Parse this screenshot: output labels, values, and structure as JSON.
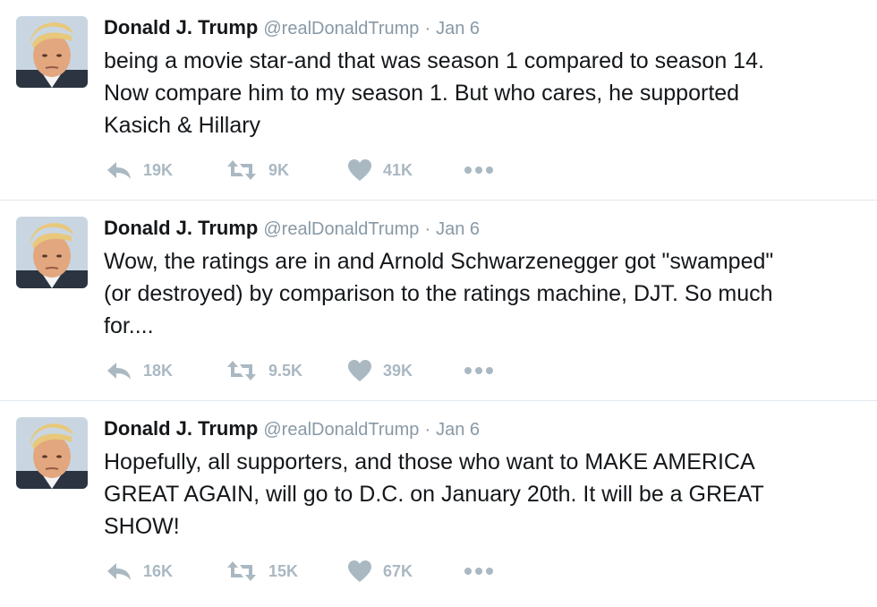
{
  "tweets": [
    {
      "author": "Donald J. Trump",
      "handle": "@realDonaldTrump",
      "separator": "·",
      "date": "Jan 6",
      "text": "being a movie star-and that was season 1 compared to season 14.\nNow compare him to my season 1. But who cares, he supported\nKasich & Hillary",
      "replies": "19K",
      "retweets": "9K",
      "likes": "41K"
    },
    {
      "author": "Donald J. Trump",
      "handle": "@realDonaldTrump",
      "separator": "·",
      "date": "Jan 6",
      "text": "Wow, the ratings are in and Arnold Schwarzenegger got \"swamped\"\n(or destroyed) by comparison to the ratings machine, DJT. So much\nfor....",
      "replies": "18K",
      "retweets": "9.5K",
      "likes": "39K"
    },
    {
      "author": "Donald J. Trump",
      "handle": "@realDonaldTrump",
      "separator": "·",
      "date": "Jan 6",
      "text": "Hopefully, all supporters, and those who want to MAKE AMERICA\nGREAT AGAIN, will go to D.C. on January 20th. It will be a GREAT\nSHOW!",
      "replies": "16K",
      "retweets": "15K",
      "likes": "67K"
    }
  ],
  "icons": {
    "reply": "reply-icon",
    "retweet": "retweet-icon",
    "like": "heart-icon",
    "more": "more-dots-icon"
  },
  "colors": {
    "name": "#14171a",
    "meta": "#8899a6",
    "action": "#aab8c2",
    "divider": "#e1e8ed"
  }
}
